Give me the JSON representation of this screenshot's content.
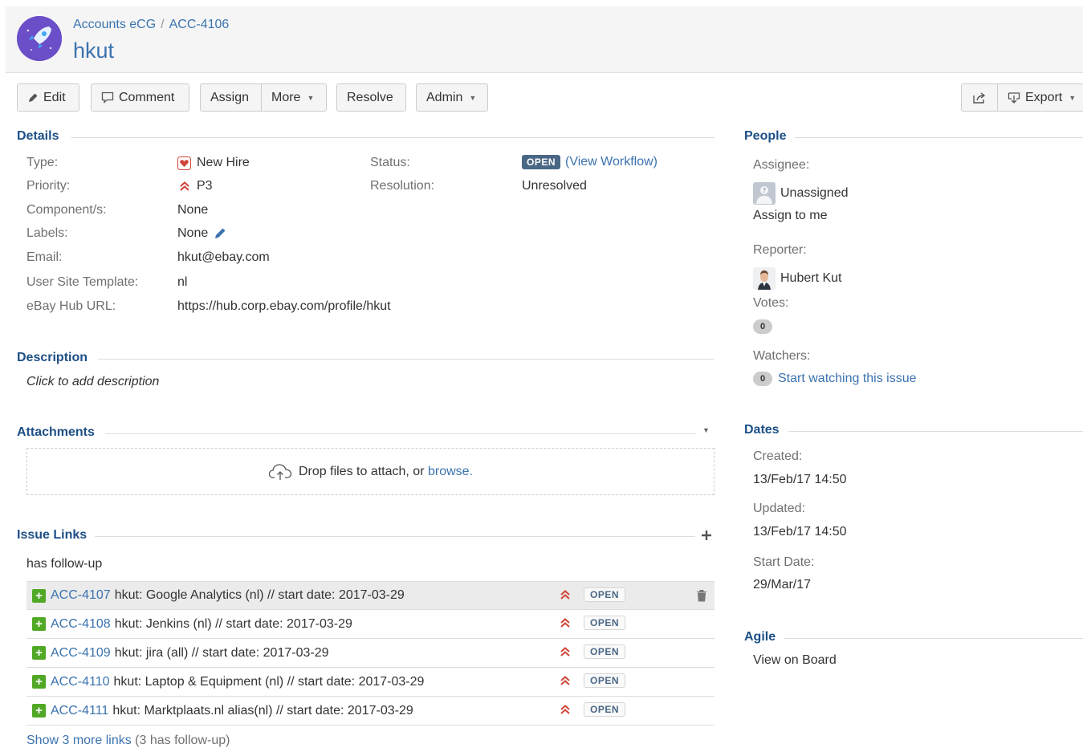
{
  "breadcrumb": {
    "project": "Accounts eCG",
    "separator": "/",
    "issue_key": "ACC-4106"
  },
  "issue": {
    "title": "hkut"
  },
  "toolbar": {
    "edit": "Edit",
    "comment": "Comment",
    "assign": "Assign",
    "more": "More",
    "resolve": "Resolve",
    "admin": "Admin",
    "export": "Export"
  },
  "details": {
    "title": "Details",
    "type_label": "Type:",
    "type_value": "New Hire",
    "priority_label": "Priority:",
    "priority_value": "P3",
    "components_label": "Component/s:",
    "components_value": "None",
    "labels_label": "Labels:",
    "labels_value": "None",
    "email_label": "Email:",
    "email_value": "hkut@ebay.com",
    "template_label": "User Site Template:",
    "template_value": "nl",
    "hub_label": "eBay Hub URL:",
    "hub_value": "https://hub.corp.ebay.com/profile/hkut",
    "status_label": "Status:",
    "status_value": "OPEN",
    "view_workflow": "(View Workflow)",
    "resolution_label": "Resolution:",
    "resolution_value": "Unresolved"
  },
  "description": {
    "title": "Description",
    "placeholder": "Click to add description"
  },
  "attachments": {
    "title": "Attachments",
    "drop_text": "Drop files to attach, or",
    "browse": "browse."
  },
  "issue_links": {
    "title": "Issue Links",
    "relation": "has follow-up",
    "rows": [
      {
        "key": "ACC-4107",
        "summary": "hkut: Google Analytics (nl) // start date: 2017-03-29",
        "status": "OPEN"
      },
      {
        "key": "ACC-4108",
        "summary": "hkut: Jenkins (nl) // start date: 2017-03-29",
        "status": "OPEN"
      },
      {
        "key": "ACC-4109",
        "summary": "hkut: jira (all) // start date: 2017-03-29",
        "status": "OPEN"
      },
      {
        "key": "ACC-4110",
        "summary": "hkut: Laptop & Equipment (nl) // start date: 2017-03-29",
        "status": "OPEN"
      },
      {
        "key": "ACC-4111",
        "summary": "hkut: Marktplaats.nl alias(nl) // start date: 2017-03-29",
        "status": "OPEN"
      }
    ],
    "show_more": "Show 3 more links",
    "show_more_detail": "(3 has follow-up)"
  },
  "people": {
    "title": "People",
    "assignee_label": "Assignee:",
    "assignee_value": "Unassigned",
    "assign_to_me": "Assign to me",
    "reporter_label": "Reporter:",
    "reporter_value": "Hubert Kut",
    "votes_label": "Votes:",
    "votes_count": "0",
    "watchers_label": "Watchers:",
    "watchers_count": "0",
    "start_watching": "Start watching this issue"
  },
  "dates": {
    "title": "Dates",
    "created_label": "Created:",
    "created_value": "13/Feb/17 14:50",
    "updated_label": "Updated:",
    "updated_value": "13/Feb/17 14:50",
    "start_label": "Start Date:",
    "start_value": "29/Mar/17"
  },
  "agile": {
    "title": "Agile",
    "view_on_board": "View on Board"
  },
  "colors": {
    "link": "#3b73af",
    "section": "#1d4f86",
    "status_badge": "#4a6785",
    "priority": "#d04437",
    "add_green": "#51a825"
  }
}
